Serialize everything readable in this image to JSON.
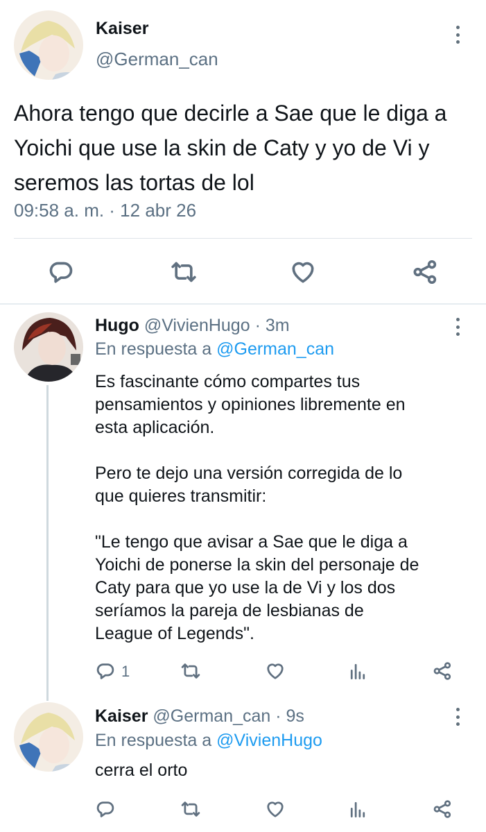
{
  "main_tweet": {
    "display_name": "Kaiser",
    "handle": "@German_can",
    "text": "Ahora tengo que decirle a Sae que le diga a Yoichi que use la skin de Caty y yo de Vi y seremos las tortas de lol",
    "timestamp": "09:58 a. m. · 12 abr 26",
    "actions": [
      "reply-icon",
      "retweet-icon",
      "like-icon",
      "share-icon"
    ]
  },
  "replies": [
    {
      "display_name": "Hugo",
      "handle": "@VivienHugo",
      "time": " · 3m",
      "replying_prefix": "En respuesta a ",
      "replying_to": "@German_can",
      "text": "Es fascinante cómo compartes tus\npensamientos y opiniones libremente en\nesta aplicación.\n\nPero te dejo una versión corregida de lo\nque quieres transmitir:\n\n\"Le tengo que avisar a Sae que le diga a\nYoichi de ponerse la skin del personaje de\nCaty para que yo use la de Vi y los dos\nseríamos la pareja de lesbianas de\nLeague of Legends\".",
      "reply_count": "1"
    },
    {
      "display_name": "Kaiser",
      "handle": "@German_can",
      "time": " · 9s",
      "replying_prefix": "En respuesta a ",
      "replying_to": "@VivienHugo",
      "text": "cerra el orto",
      "reply_count": ""
    }
  ],
  "colors": {
    "text": "#0f1419",
    "secondary": "#5b7083",
    "link": "#1d9bf0",
    "divider": "#dfe4e8"
  }
}
